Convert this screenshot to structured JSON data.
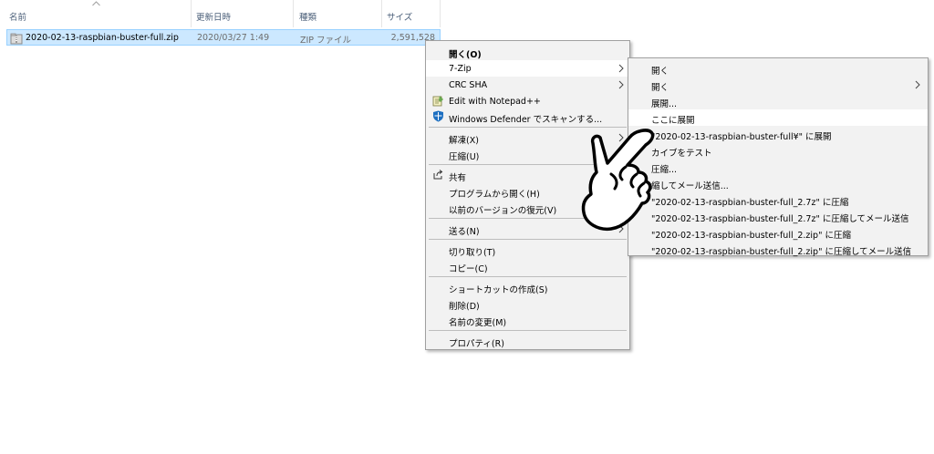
{
  "columns": {
    "name": "名前",
    "date": "更新日時",
    "type": "種類",
    "size": "サイズ"
  },
  "file": {
    "name": "2020-02-13-raspbian-buster-full.zip",
    "date": "2020/03/27 1:49",
    "type": "ZIP ファイル",
    "size": "2,591,528"
  },
  "context_menu": {
    "open": "開く(O)",
    "seven_zip": "7-Zip",
    "crc_sha": "CRC SHA",
    "notepad": "Edit with Notepad++",
    "defender": "Windows Defender でスキャンする...",
    "extract": "解凍(X)",
    "compress": "圧縮(U)",
    "share": "共有",
    "open_with": "プログラムから開く(H)",
    "restore": "以前のバージョンの復元(V)",
    "send_to": "送る(N)",
    "cut": "切り取り(T)",
    "copy": "コピー(C)",
    "shortcut": "ショートカットの作成(S)",
    "delete": "削除(D)",
    "rename": "名前の変更(M)",
    "properties": "プロパティ(R)"
  },
  "submenu": {
    "open1": "開く",
    "open2": "開く",
    "extract_files": "展開...",
    "extract_here": "ここに展開",
    "extract_to": "\"2020-02-13-raspbian-buster-full¥\" に展開",
    "test_archive": "カイブをテスト",
    "add_to_archive": "圧縮...",
    "compress_email": "縮してメール送信...",
    "add_7z": "\"2020-02-13-raspbian-buster-full_2.7z\" に圧縮",
    "add_7z_email": "\"2020-02-13-raspbian-buster-full_2.7z\" に圧縮してメール送信",
    "add_zip": "\"2020-02-13-raspbian-buster-full_2.zip\" に圧縮",
    "add_zip_email": "\"2020-02-13-raspbian-buster-full_2.zip\" に圧縮してメール送信"
  },
  "colors": {
    "selection": "#cce8ff",
    "menu_bg": "#f2f2f2",
    "highlight": "#ffffff"
  }
}
